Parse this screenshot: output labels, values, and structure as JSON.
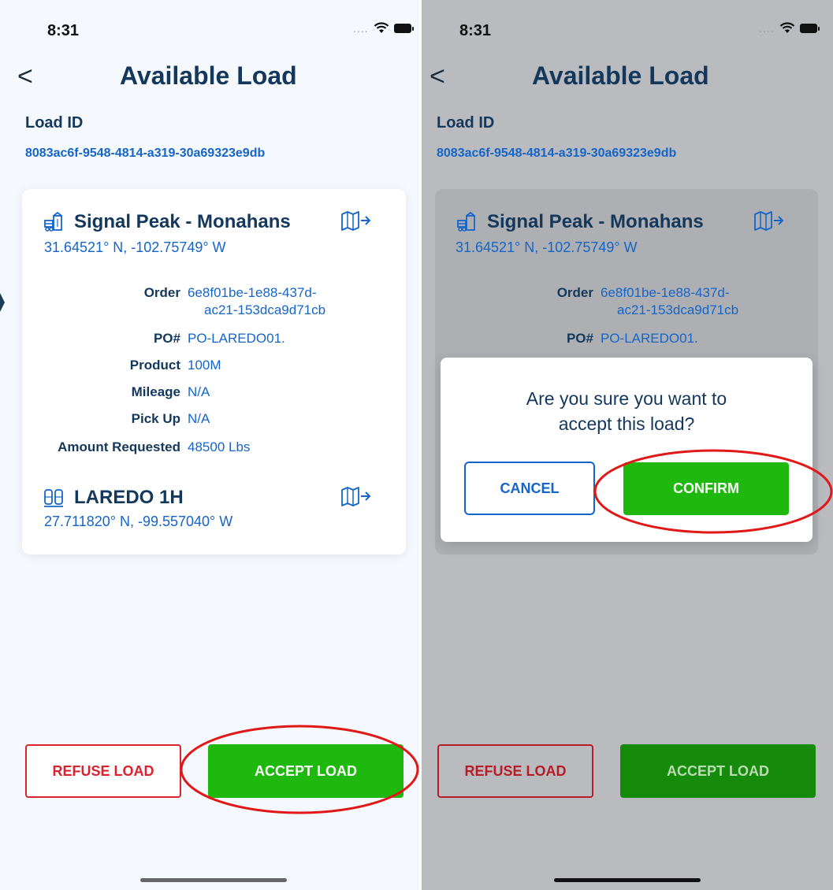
{
  "status": {
    "time": "8:31",
    "dots": "....",
    "icons": [
      "wifi-icon",
      "battery-icon"
    ]
  },
  "header": {
    "back_glyph": "<",
    "title": "Available Load"
  },
  "load": {
    "id_label": "Load ID",
    "id_value": "8083ac6f-9548-4814-a319-30a69323e9db"
  },
  "pickup": {
    "name": "Signal Peak - Monahans",
    "coords": "31.64521° N, -102.75749° W",
    "icon": "silo-icon",
    "map_icon": "map-navigate-icon"
  },
  "details": [
    {
      "label": "Order",
      "value": "6e8f01be-1e88-437d-ac21-153dca9d71cb",
      "value_line1": "6e8f01be-1e88-437d-",
      "value_line2": "ac21-153dca9d71cb"
    },
    {
      "label": "PO#",
      "value": "PO-LAREDO01."
    },
    {
      "label": "Product",
      "value": "100M"
    },
    {
      "label": "Mileage",
      "value": "N/A"
    },
    {
      "label": "Pick Up",
      "value": "N/A"
    },
    {
      "label": "Amount Requested",
      "value": "48500 Lbs"
    }
  ],
  "dropoff": {
    "name": "LAREDO 1H",
    "coords": "27.711820° N, -99.557040° W",
    "icon": "tank-icon",
    "map_icon": "map-navigate-icon"
  },
  "actions": {
    "refuse": "REFUSE LOAD",
    "accept": "ACCEPT LOAD"
  },
  "dialog": {
    "message_line1": "Are you sure you want to",
    "message_line2": "accept this load?",
    "cancel": "CANCEL",
    "confirm": "CONFIRM"
  },
  "colors": {
    "title": "#14385c",
    "link_blue": "#1565c8",
    "accept_green": "#1fb80e",
    "refuse_red": "#d9232f",
    "annotation_red": "#e01818",
    "overlay_gray": "#b9bbbf"
  }
}
